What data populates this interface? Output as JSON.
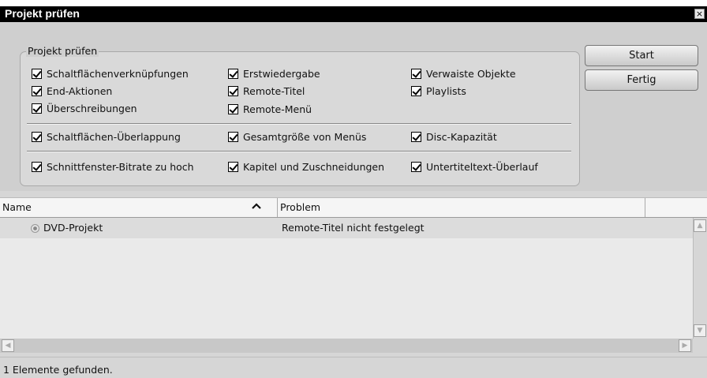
{
  "window": {
    "title": "Projekt prüfen",
    "close_glyph": "×"
  },
  "group": {
    "legend": "Projekt prüfen"
  },
  "checks": {
    "row1": [
      {
        "label": "Schaltflächenverknüpfungen",
        "checked": true
      },
      {
        "label": "Erstwiedergabe",
        "checked": true
      },
      {
        "label": "Verwaiste Objekte",
        "checked": true
      }
    ],
    "row2": [
      {
        "label": "End-Aktionen",
        "checked": true
      },
      {
        "label": "Remote-Titel",
        "checked": true
      },
      {
        "label": "Playlists",
        "checked": true
      }
    ],
    "row3": [
      {
        "label": "Überschreibungen",
        "checked": true
      },
      {
        "label": "Remote-Menü",
        "checked": true
      }
    ],
    "row4": [
      {
        "label": "Schaltflächen-Überlappung",
        "checked": true
      },
      {
        "label": "Gesamtgröße von Menüs",
        "checked": true
      },
      {
        "label": "Disc-Kapazität",
        "checked": true
      }
    ],
    "row5": [
      {
        "label": "Schnittfenster-Bitrate zu hoch",
        "checked": true
      },
      {
        "label": "Kapitel und Zuschneidungen",
        "checked": true
      },
      {
        "label": "Untertiteltext-Überlauf",
        "checked": true
      }
    ]
  },
  "buttons": {
    "start": "Start",
    "done": "Fertig"
  },
  "list": {
    "columns": [
      "Name",
      "Problem"
    ],
    "sort_icon": "sort-ascending-icon",
    "rows": [
      {
        "name": "DVD-Projekt",
        "problem": "Remote-Titel nicht festgelegt",
        "icon": "disc-icon"
      }
    ]
  },
  "status": {
    "text": "1 Elemente gefunden."
  }
}
